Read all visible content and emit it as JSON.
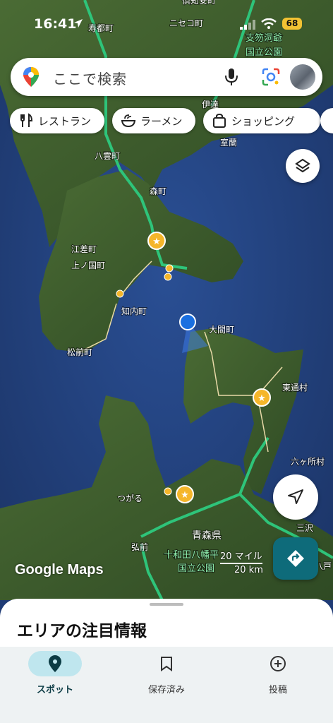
{
  "status": {
    "time": "16:41",
    "battery": "68"
  },
  "search": {
    "placeholder": "ここで検索"
  },
  "chips": [
    {
      "label": "レストラン",
      "icon": "fork-knife-icon"
    },
    {
      "label": "ラーメン",
      "icon": "ramen-bowl-icon"
    },
    {
      "label": "ショッピング",
      "icon": "shopping-bag-icon"
    }
  ],
  "map": {
    "labels": [
      "寿都町",
      "ニセコ町",
      "倶知安町",
      "支笏洞爺",
      "国立公園",
      "伊達",
      "室蘭",
      "八雲町",
      "森町",
      "江差町",
      "上ノ国町",
      "知内町",
      "松前町",
      "大間町",
      "東通村",
      "六ヶ所村",
      "つがる",
      "弘前",
      "青森県",
      "十和田八幡平",
      "国立公園",
      "三沢",
      "八戸"
    ],
    "brand": "Google Maps",
    "scale": {
      "miles": "20 マイル",
      "km": "20 km"
    }
  },
  "sheet": {
    "title": "エリアの注目情報"
  },
  "nav": [
    {
      "label": "スポット",
      "icon": "location-pin-icon",
      "active": true
    },
    {
      "label": "保存済み",
      "icon": "bookmark-icon",
      "active": false
    },
    {
      "label": "投稿",
      "icon": "add-circle-icon",
      "active": false
    }
  ],
  "colors": {
    "accent": "#0e6b7a",
    "water": "#1f3b75",
    "land": "#3c5a2c",
    "road": "#2ec47a",
    "my_location": "#1a6fe0"
  }
}
